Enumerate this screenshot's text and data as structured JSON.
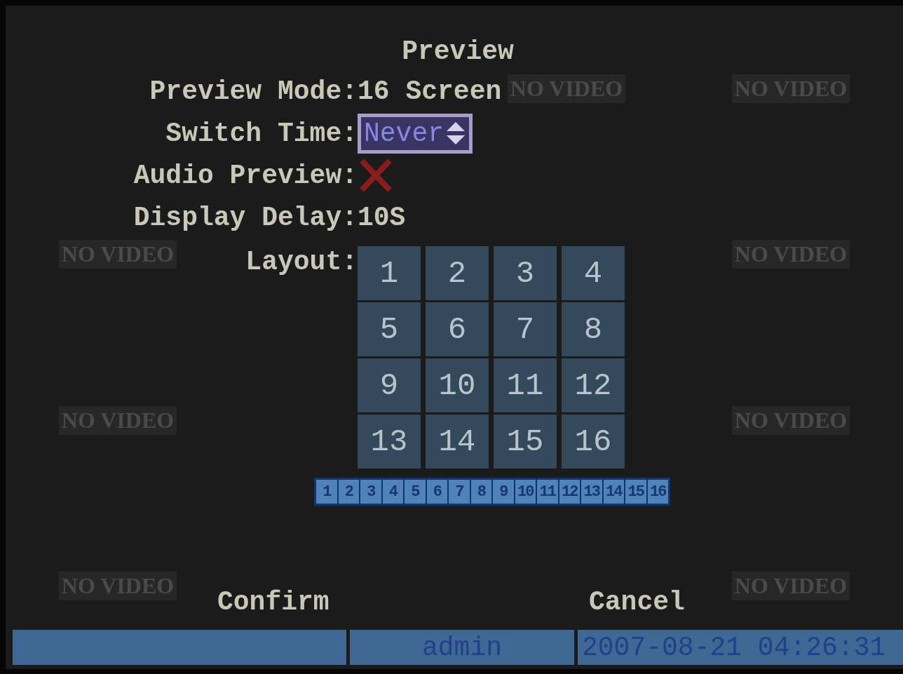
{
  "background": {
    "tiles": [
      {
        "kind": "blank"
      },
      {
        "kind": "blank"
      },
      {
        "kind": "labeled",
        "label": "NO VIDEO"
      },
      {
        "kind": "labeled",
        "label": "NO VIDEO"
      },
      {
        "kind": "labeled",
        "label": "NO VIDEO"
      },
      {
        "kind": "blank"
      },
      {
        "kind": "blank"
      },
      {
        "kind": "labeled",
        "label": "NO VIDEO"
      },
      {
        "kind": "labeled",
        "label": "NO VIDEO"
      },
      {
        "kind": "blank"
      },
      {
        "kind": "blank"
      },
      {
        "kind": "labeled",
        "label": "NO VIDEO"
      },
      {
        "kind": "labeled",
        "label": "NO VIDEO"
      },
      {
        "kind": "blank"
      },
      {
        "kind": "blank"
      },
      {
        "kind": "labeled",
        "label": "NO VIDEO"
      }
    ]
  },
  "menu": {
    "title": "Preview",
    "fields": [
      {
        "kind": "text",
        "label": "Preview Mode:",
        "value": "16 Screen"
      },
      {
        "kind": "select",
        "label": "Switch Time:",
        "value": "Never",
        "focused": true
      },
      {
        "kind": "checkbox",
        "label": "Audio Preview:",
        "checked": false
      },
      {
        "kind": "text",
        "label": "Display Delay:",
        "value": "10S"
      },
      {
        "kind": "layout",
        "label": "Layout:"
      }
    ],
    "layout_cells": [
      "1",
      "2",
      "3",
      "4",
      "5",
      "6",
      "7",
      "8",
      "9",
      "10",
      "11",
      "12",
      "13",
      "14",
      "15",
      "16"
    ],
    "channels": [
      "1",
      "2",
      "3",
      "4",
      "5",
      "6",
      "7",
      "8",
      "9",
      "10",
      "11",
      "12",
      "13",
      "14",
      "15",
      "16"
    ],
    "buttons": [
      "Confirm",
      "Cancel"
    ]
  },
  "status_bar": {
    "user": "admin",
    "datetime": "2007-08-21 04:26:31"
  }
}
